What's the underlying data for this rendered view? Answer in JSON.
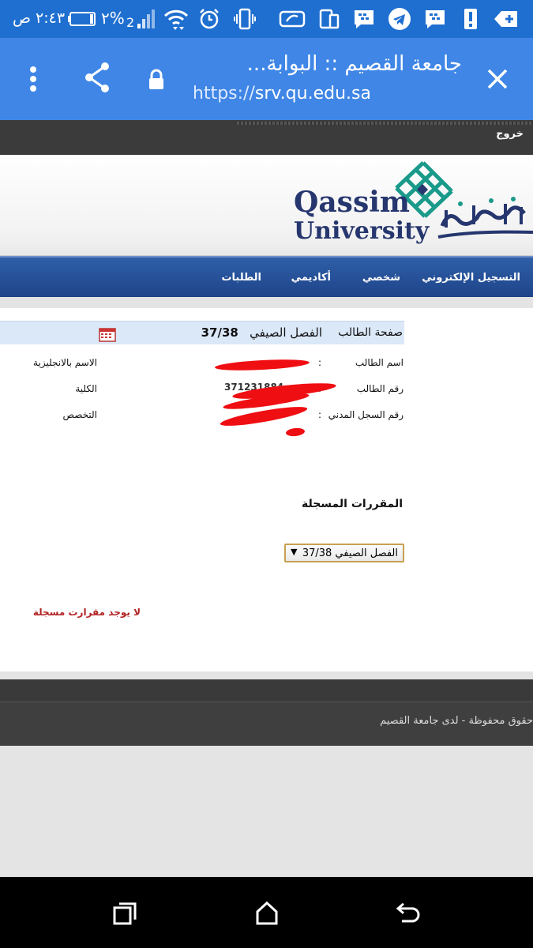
{
  "status_bar": {
    "time": "٢:٤٣ ص",
    "battery_percent": "٢%",
    "icons": [
      "battery-icon",
      "signal-icon",
      "wifi-icon",
      "alarm-icon",
      "vibrate-icon",
      "cloud-icon",
      "device-icon",
      "bbm-icon",
      "telegram-icon",
      "bbm-icon",
      "alert-icon",
      "add-icon"
    ]
  },
  "browser": {
    "title": "جامعة القصيم :: البوابة...",
    "url_scheme": "https://",
    "url_host": "srv.qu.edu.sa",
    "icons": [
      "close-icon",
      "lock-icon",
      "share-icon",
      "more-icon"
    ]
  },
  "page": {
    "logout_label": "خروج",
    "nav": {
      "items": [
        "التسجيل الإلكتروني",
        "شخصي",
        "أكاديمي",
        "الطلبات"
      ]
    },
    "student": {
      "header_label": "صفحة الطالب",
      "term_label": "الفصل الصيفي",
      "term_value": "37/38",
      "fields": {
        "name": "اسم الطالب",
        "id": "رقم الطالب",
        "civil": "رقم السجل المدني",
        "english_name": "الاسم بالانجليزية",
        "college": "الكلية",
        "major": "التخصص"
      },
      "separator": ":",
      "id_value_visible": "371231884"
    },
    "courses_heading": "المقررات المسجلة",
    "term_select": {
      "selected": "الفصل الصيفي 37/38"
    },
    "no_courses": "لا يوجد مقرارت مسجلة",
    "footer_text": "حقوق محفوظة - لدى جامعة القصيم"
  },
  "colors": {
    "status_bar": "#1f6fd0",
    "tab_bar": "#3f86e6",
    "nav_bar": "#1e4489",
    "error_text": "#b22222",
    "logo_teal": "#1a9a8a",
    "logo_navy": "#26366e"
  }
}
